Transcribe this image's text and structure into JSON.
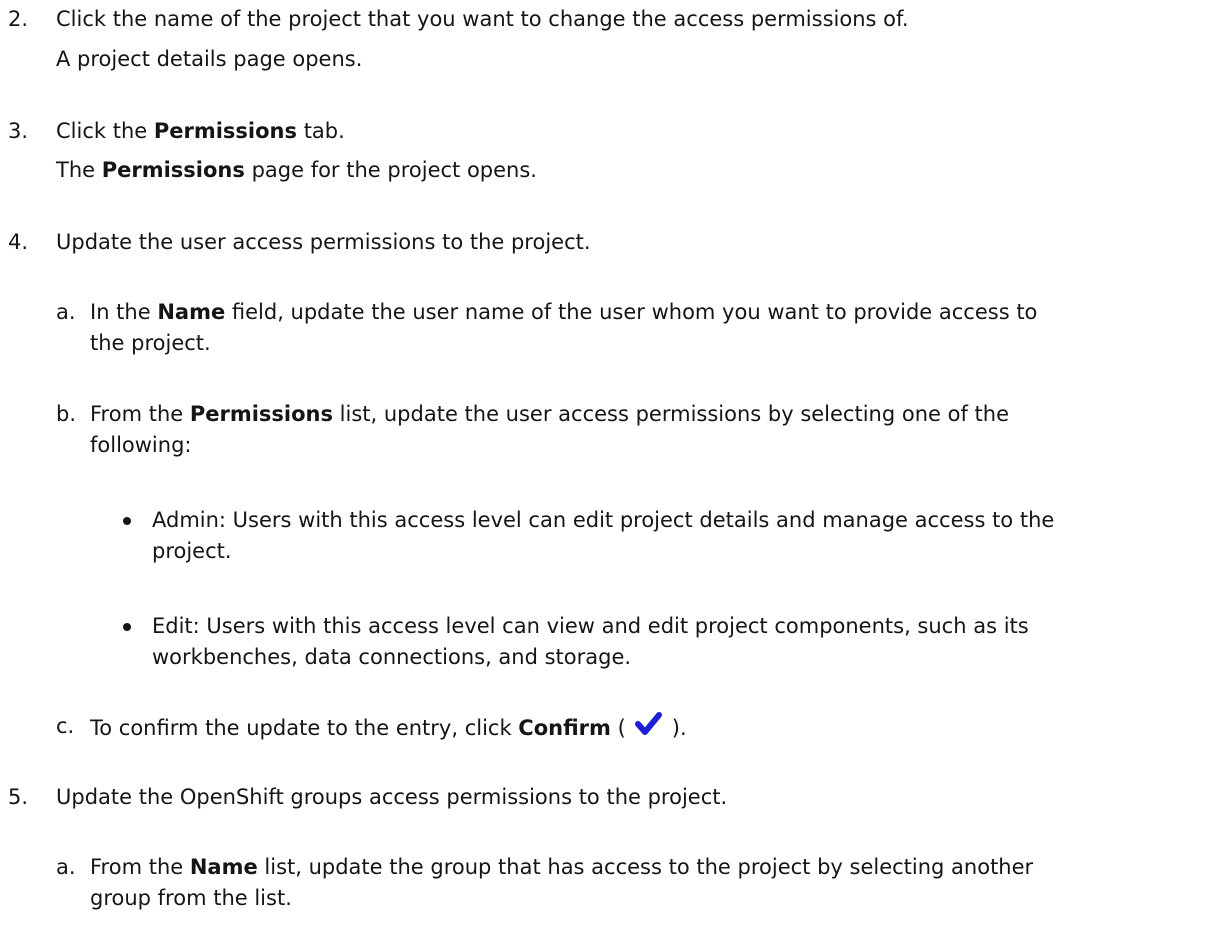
{
  "steps": {
    "s2": {
      "num": "2.",
      "line1": "Click the name of the project that you want to change the access permissions of.",
      "line2": "A project details page opens."
    },
    "s3": {
      "num": "3.",
      "line1_pre": "Click the ",
      "line1_bold": "Permissions",
      "line1_post": " tab.",
      "line2_pre": "The ",
      "line2_bold": "Permissions",
      "line2_post": " page for the project opens."
    },
    "s4": {
      "num": "4.",
      "text": "Update the user access permissions to the project.",
      "a": {
        "label": "a.",
        "pre": "In the ",
        "bold": "Name",
        "post": " field, update the user name of the user whom you want to provide access to",
        "cont": "the project."
      },
      "b": {
        "label": "b.",
        "pre": "From the ",
        "bold": "Permissions",
        "post": " list, update the user access permissions by selecting one of the",
        "cont": "following:",
        "bullets": [
          {
            "line1": "Admin: Users with this access level can edit project details and manage access to the",
            "line2": "project."
          },
          {
            "line1": "Edit: Users with this access level can view and edit project components, such as its",
            "line2": "workbenches, data connections, and storage."
          }
        ]
      },
      "c": {
        "label": "c.",
        "pre": "To confirm the update to the entry, click ",
        "bold": "Confirm",
        "open": " (",
        "close": ")."
      }
    },
    "s5": {
      "num": "5.",
      "text": "Update the OpenShift groups access permissions to the project.",
      "a": {
        "label": "a.",
        "pre": "From the ",
        "bold": "Name",
        "post": " list, update the group that has access to the project by selecting another",
        "cont": "group from the list."
      }
    }
  },
  "colors": {
    "text": "#151515",
    "check_icon": "#1f1fd6"
  },
  "icons": {
    "confirm": "checkmark-icon"
  }
}
